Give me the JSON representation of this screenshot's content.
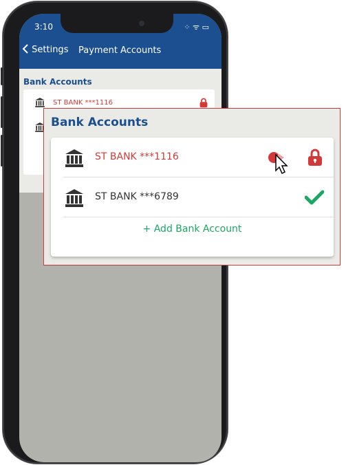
{
  "status_bar": {
    "time": "3:10",
    "icons": "⁘ ᯤ ▭"
  },
  "nav": {
    "back_label": "Settings",
    "title": "Payment Accounts"
  },
  "section": {
    "title": "Bank Accounts"
  },
  "accounts": [
    {
      "name": "ST BANK ***1116",
      "status": "locked",
      "color": "#d23a3a"
    },
    {
      "name": "ST BANK ***6789",
      "status": "default",
      "color": "#333333"
    }
  ],
  "add_button_label": "+ Add Bank Account",
  "colors": {
    "header": "#1c4f8f",
    "accent_green": "#1aa864",
    "locked_red": "#d23a3a"
  }
}
